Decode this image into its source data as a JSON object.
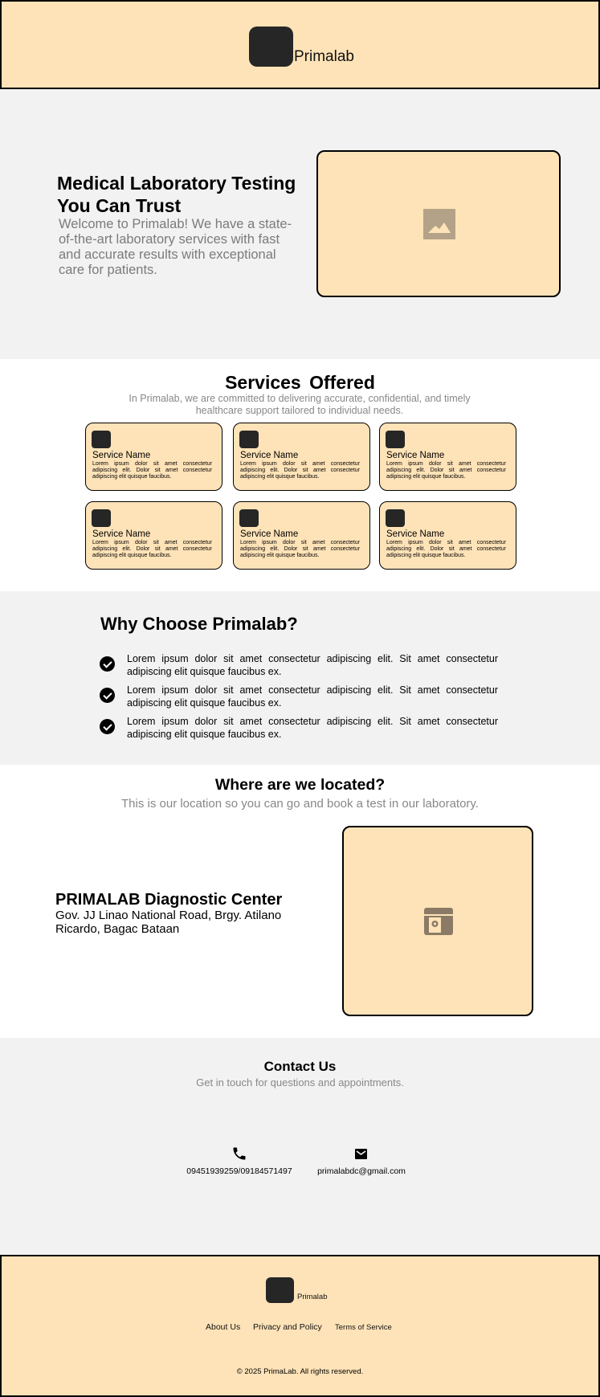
{
  "header": {
    "brand": "Primalab"
  },
  "hero": {
    "title": "Medical Laboratory Testing You Can Trust",
    "description": "Welcome to Primalab! We have a state-of-the-art laboratory services with fast and accurate results with exceptional care for patients."
  },
  "services": {
    "title": "Services  Offered",
    "subtitle": "In Primalab, we are committed to delivering accurate, confidential, and timely healthcare support tailored to individual needs.",
    "items": [
      {
        "name": "Service Name",
        "description": "Lorem ipsum dolor sit amet consectetur adipiscing elit. Dolor sit amet consectetur adipiscing elit quisque faucibus."
      },
      {
        "name": "Service Name",
        "description": "Lorem ipsum dolor sit amet consectetur adipiscing elit. Dolor sit amet consectetur adipiscing elit quisque faucibus."
      },
      {
        "name": "Service Name",
        "description": "Lorem ipsum dolor sit amet consectetur adipiscing elit. Dolor sit amet consectetur adipiscing elit quisque faucibus."
      },
      {
        "name": "Service Name",
        "description": "Lorem ipsum dolor sit amet consectetur adipiscing elit. Dolor sit amet consectetur adipiscing elit quisque faucibus."
      },
      {
        "name": "Service Name",
        "description": "Lorem ipsum dolor sit amet consectetur adipiscing elit. Dolor sit amet consectetur adipiscing elit quisque faucibus."
      },
      {
        "name": "Service Name",
        "description": "Lorem ipsum dolor sit amet consectetur adipiscing elit. Dolor sit amet consectetur adipiscing elit quisque faucibus."
      }
    ]
  },
  "why": {
    "title": "Why Choose Primalab?",
    "points": [
      "Lorem ipsum dolor sit amet consectetur adipiscing elit. Sit amet consectetur adipiscing elit quisque faucibus ex.",
      "Lorem ipsum dolor sit amet consectetur adipiscing elit. Sit amet consectetur adipiscing elit quisque faucibus ex.",
      "Lorem ipsum dolor sit amet consectetur adipiscing elit. Sit amet consectetur adipiscing elit quisque faucibus ex."
    ]
  },
  "location": {
    "title": "Where are we located?",
    "subtitle": "This is our location so you can go and book a test in our laboratory.",
    "center_name": "PRIMALAB Diagnostic Center",
    "address": "Gov. JJ Linao National Road, Brgy. Atilano Ricardo, Bagac Bataan"
  },
  "contact": {
    "title": "Contact Us",
    "subtitle": "Get in touch for questions and appointments.",
    "phone": "09451939259/09184571497",
    "email": "primalabdc@gmail.com"
  },
  "footer": {
    "brand": "Primalab",
    "links": [
      "About Us",
      "Privacy and Policy",
      "Terms of Service"
    ],
    "copyright": "© 2025 PrimaLab. All rights reserved."
  },
  "colors": {
    "accent": "#ffe3b8",
    "dark": "#262626",
    "section_gray": "#f2f2f2",
    "muted_text": "#888888"
  },
  "icons": [
    "logo-icon",
    "image-placeholder-icon",
    "check-circle-icon",
    "map-placeholder-icon",
    "phone-icon",
    "mail-icon"
  ]
}
